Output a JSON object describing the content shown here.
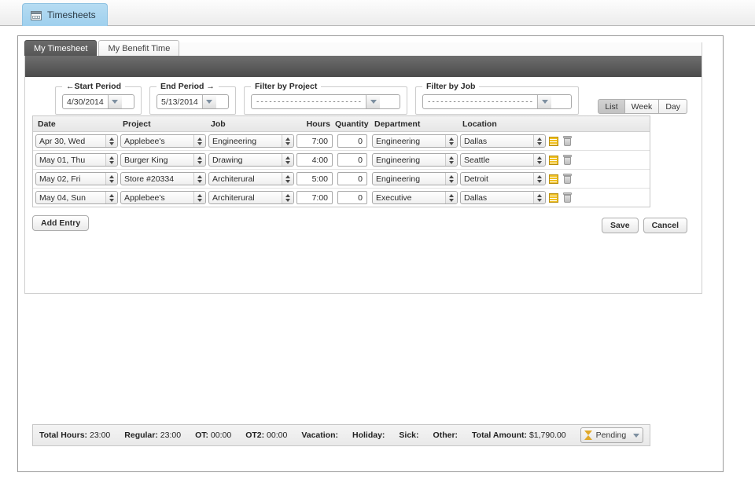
{
  "app": {
    "tab_label": "Timesheets",
    "tab_icon": "calendar-icon"
  },
  "subtabs": [
    {
      "label": "My Timesheet",
      "active": true
    },
    {
      "label": "My Benefit Time",
      "active": false
    }
  ],
  "filters": {
    "start_period": {
      "legend": "←Start Period",
      "value": "4/30/2014"
    },
    "end_period": {
      "legend": "End Period →",
      "value": "5/13/2014"
    },
    "filter_by_project": {
      "legend": "Filter by Project",
      "value": "-------------------------"
    },
    "filter_by_job": {
      "legend": "Filter by Job",
      "value": "-------------------------"
    }
  },
  "view_modes": [
    {
      "label": "List",
      "active": true
    },
    {
      "label": "Week",
      "active": false
    },
    {
      "label": "Day",
      "active": false
    }
  ],
  "grid": {
    "headers": {
      "date": "Date",
      "project": "Project",
      "job": "Job",
      "hours": "Hours",
      "quantity": "Quantity",
      "department": "Department",
      "location": "Location"
    },
    "rows": [
      {
        "date": "Apr 30, Wed",
        "project": "Applebee's",
        "job": "Engineering",
        "hours": "7:00",
        "quantity": "0",
        "department": "Engineering",
        "location": "Dallas"
      },
      {
        "date": "May 01, Thu",
        "project": "Burger King",
        "job": "Drawing",
        "hours": "4:00",
        "quantity": "0",
        "department": "Engineering",
        "location": "Seattle"
      },
      {
        "date": "May 02, Fri",
        "project": "Store #20334",
        "job": "Architerural",
        "hours": "5:00",
        "quantity": "0",
        "department": "Engineering",
        "location": "Detroit"
      },
      {
        "date": "May 04, Sun",
        "project": "Applebee's",
        "job": "Architerural",
        "hours": "7:00",
        "quantity": "0",
        "department": "Executive",
        "location": "Dallas"
      }
    ]
  },
  "actions": {
    "add_entry": "Add Entry",
    "save": "Save",
    "cancel": "Cancel"
  },
  "summary": {
    "total_hours_label": "Total Hours:",
    "total_hours_value": "23:00",
    "regular_label": "Regular:",
    "regular_value": "23:00",
    "ot_label": "OT:",
    "ot_value": "00:00",
    "ot2_label": "OT2:",
    "ot2_value": "00:00",
    "vacation_label": "Vacation:",
    "vacation_value": "",
    "holiday_label": "Holiday:",
    "holiday_value": "",
    "sick_label": "Sick:",
    "sick_value": "",
    "other_label": "Other:",
    "other_value": "",
    "total_amount_label": "Total Amount:",
    "total_amount_value": "$1,790.00",
    "status": "Pending",
    "status_icon": "hourglass-icon"
  },
  "colors": {
    "app_tab_accent": "#9fd0ee",
    "dark_band": "#4b4b4b",
    "note_icon": "#f0c020",
    "status_icon": "#e0a92b"
  }
}
